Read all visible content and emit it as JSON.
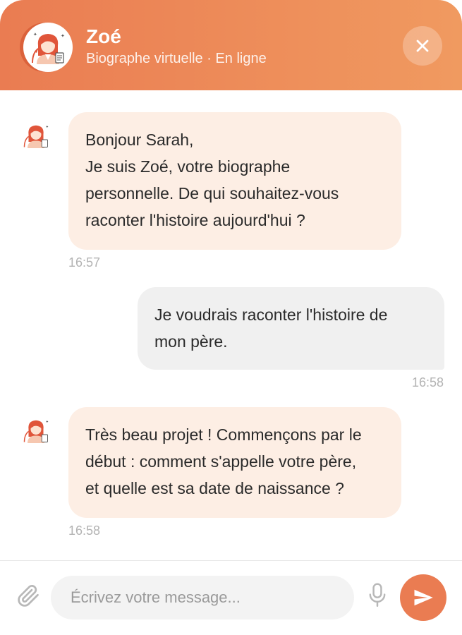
{
  "header": {
    "name": "Zoé",
    "subtitle": "Biographe virtuelle · En ligne",
    "avatar_icon": "woman-writer-avatar",
    "close_icon": "close-icon"
  },
  "messages": [
    {
      "sender": "bot",
      "lines": [
        "Bonjour Sarah,",
        "Je suis Zoé, votre biographe",
        "personnelle. De qui souhaitez-vous",
        "raconter l'histoire aujourd'hui ?"
      ],
      "time": "16:57"
    },
    {
      "sender": "user",
      "lines": [
        "Je voudrais raconter l'histoire de",
        "mon père."
      ],
      "time": "16:58"
    },
    {
      "sender": "bot",
      "lines": [
        "Très beau projet ! Commençons par le",
        "début : comment s'appelle votre père,",
        "et quelle est sa date de naissance ?"
      ],
      "time": "16:58"
    }
  ],
  "composer": {
    "placeholder": "Écrivez votre message...",
    "value": "",
    "attach_icon": "paperclip-icon",
    "mic_icon": "microphone-icon",
    "send_icon": "send-icon"
  },
  "colors": {
    "accent": "#ea7c52",
    "accent_light": "#f09a60",
    "bot_bubble": "#fdeee4",
    "user_bubble": "#f0f0f0"
  }
}
